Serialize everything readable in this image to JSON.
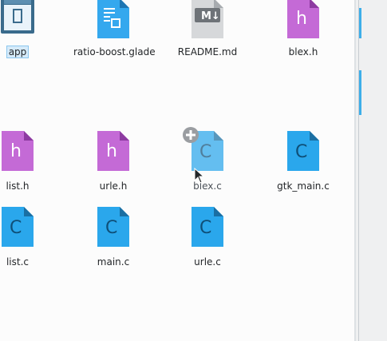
{
  "files": [
    {
      "name": "app",
      "type": "executable",
      "selected": true
    },
    {
      "name": "ratio-boost.glade",
      "type": "glade"
    },
    {
      "name": "README.md",
      "type": "markdown"
    },
    {
      "name": "blex.h",
      "type": "header"
    },
    {
      "name": "list.h",
      "type": "header"
    },
    {
      "name": "urle.h",
      "type": "header"
    },
    {
      "name": "blex.c",
      "type": "c-source",
      "dragging": true
    },
    {
      "name": "gtk_main.c",
      "type": "c-source"
    },
    {
      "name": "list.c",
      "type": "c-source"
    },
    {
      "name": "main.c",
      "type": "c-source"
    },
    {
      "name": "urle.c",
      "type": "c-source"
    }
  ],
  "colors": {
    "header": "#c46ad6",
    "c_source": "#2aa7ec",
    "glade": "#34a8ee",
    "markdown": "#d6d8da",
    "selection": "#d6ebfa",
    "accent": "#3daee9"
  },
  "icons": {
    "header": "h-file-icon",
    "c_source": "c-file-icon",
    "glade": "glade-file-icon",
    "markdown": "markdown-file-icon",
    "executable": "window-app-icon",
    "drag_add": "plus-badge-icon",
    "cursor": "arrow-cursor-icon"
  }
}
